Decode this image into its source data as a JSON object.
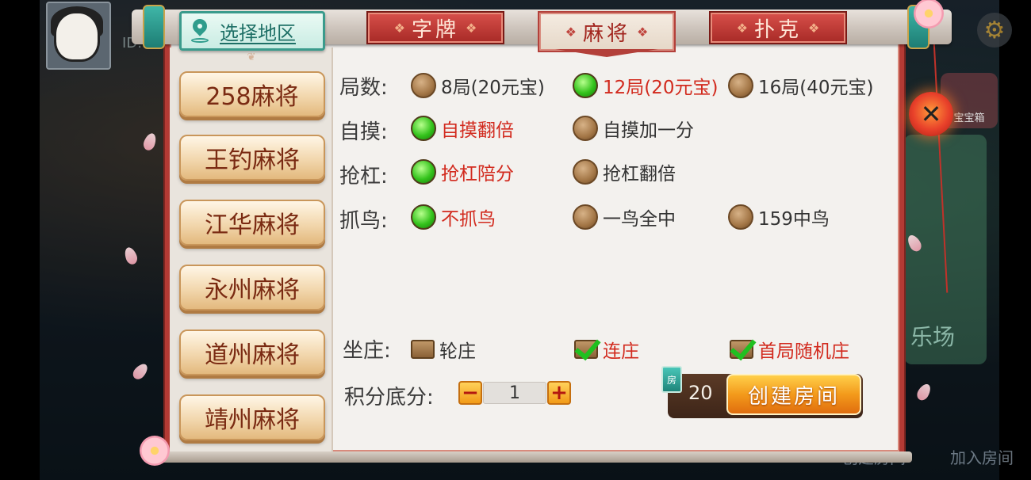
{
  "background": {
    "id_label": "ID:",
    "bottom_buttons": [
      "创建房间",
      "加入房间"
    ],
    "right_label": "乐场",
    "treasure_label": "宝宝箱"
  },
  "region": {
    "label": "选择地区"
  },
  "category_tabs": [
    {
      "label": "字牌",
      "active": false
    },
    {
      "label": "麻将",
      "active": true
    },
    {
      "label": "扑克",
      "active": false
    }
  ],
  "games": [
    "258麻将",
    "王钓麻将",
    "江华麻将",
    "永州麻将",
    "道州麻将",
    "靖州麻将"
  ],
  "options": {
    "rounds": {
      "label": "局数:",
      "items": [
        {
          "text": "8局(20元宝)",
          "selected": false
        },
        {
          "text": "12局(20元宝)",
          "selected": true
        },
        {
          "text": "16局(40元宝)",
          "selected": false
        }
      ]
    },
    "zimo": {
      "label": "自摸:",
      "items": [
        {
          "text": "自摸翻倍",
          "selected": true
        },
        {
          "text": "自摸加一分",
          "selected": false
        }
      ]
    },
    "qianggang": {
      "label": "抢杠:",
      "items": [
        {
          "text": "抢杠陪分",
          "selected": true
        },
        {
          "text": "抢杠翻倍",
          "selected": false
        }
      ]
    },
    "zhuaniao": {
      "label": "抓鸟:",
      "items": [
        {
          "text": "不抓鸟",
          "selected": true
        },
        {
          "text": "一鸟全中",
          "selected": false
        },
        {
          "text": "159中鸟",
          "selected": false
        }
      ]
    },
    "zuozhuang": {
      "label": "坐庄:",
      "items": [
        {
          "text": "轮庄",
          "checked": false
        },
        {
          "text": "连庄",
          "checked": true
        },
        {
          "text": "首局随机庄",
          "checked": true
        }
      ]
    }
  },
  "score": {
    "label": "积分底分:",
    "value": "1",
    "minus": "−",
    "plus": "+"
  },
  "create": {
    "cost": "20",
    "label": "创建房间",
    "currency_badge": "房"
  },
  "close_glyph": "✕",
  "settings_glyph": "⚙"
}
